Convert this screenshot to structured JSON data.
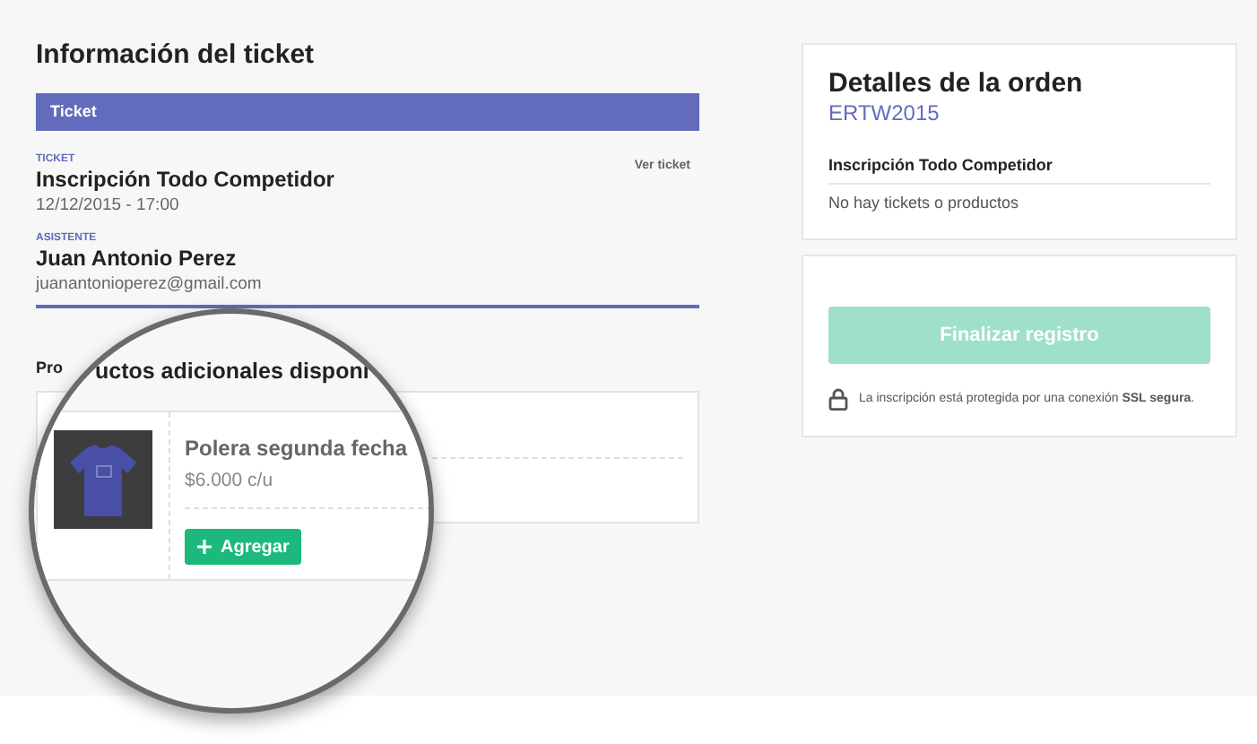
{
  "title": "Información del ticket",
  "section_bar": "Ticket",
  "ticket": {
    "label": "TICKET",
    "name": "Inscripción Todo Competidor",
    "date": "12/12/2015 - 17:00",
    "link": "Ver ticket"
  },
  "attendee": {
    "label": "ASISTENTE",
    "name": "Juan Antonio Perez",
    "email": "juanantonioperez@gmail.com"
  },
  "products_heading": "Pro",
  "magnifier": {
    "heading": "uctos adicionales disponi",
    "product": {
      "name": "Polera segunda fecha",
      "price": "$6.000 c/u",
      "button": "Agregar"
    }
  },
  "order": {
    "title": "Detalles de la orden",
    "code": "ERTW2015",
    "item": "Inscripción Todo Competidor",
    "empty": "No hay tickets o productos"
  },
  "checkout": {
    "button": "Finalizar registro",
    "disabled": true,
    "notice": "La inscripción está protegida por una conexión **SSL segura**."
  }
}
